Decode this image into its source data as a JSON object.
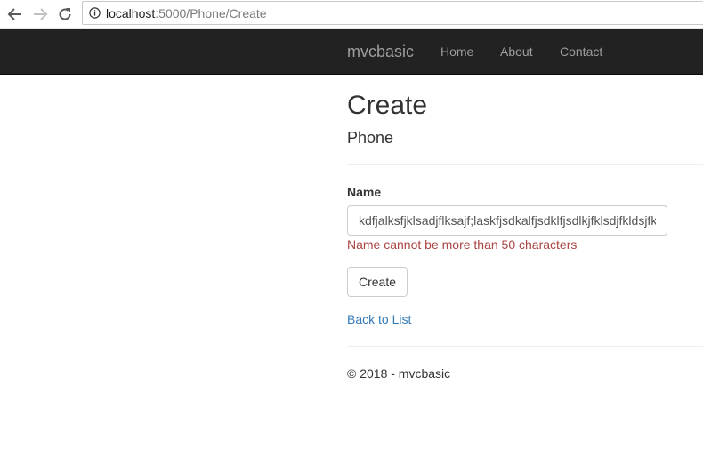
{
  "browser": {
    "back_icon": "arrow-left-icon",
    "forward_icon": "arrow-right-icon",
    "reload_icon": "reload-icon",
    "info_icon": "info-icon",
    "url_host": "localhost",
    "url_path": ":5000/Phone/Create"
  },
  "navbar": {
    "brand": "mvcbasic",
    "links": [
      {
        "label": "Home"
      },
      {
        "label": "About"
      },
      {
        "label": "Contact"
      }
    ],
    "background": "#222222",
    "link_color": "#9d9d9d"
  },
  "page": {
    "title": "Create",
    "subtitle": "Phone"
  },
  "form": {
    "name_label": "Name",
    "name_value": "kdfjalksfjklsadjflksajf;laskfjsdkalfjsdklfjsdlkjfklsdjfkldsjfkldsjf",
    "name_error": "Name cannot be more than 50 characters",
    "error_color": "#a94442",
    "submit_label": "Create"
  },
  "links": {
    "back_to_list": "Back to List",
    "link_color": "#337ab7"
  },
  "footer": {
    "text": "© 2018 - mvcbasic"
  }
}
